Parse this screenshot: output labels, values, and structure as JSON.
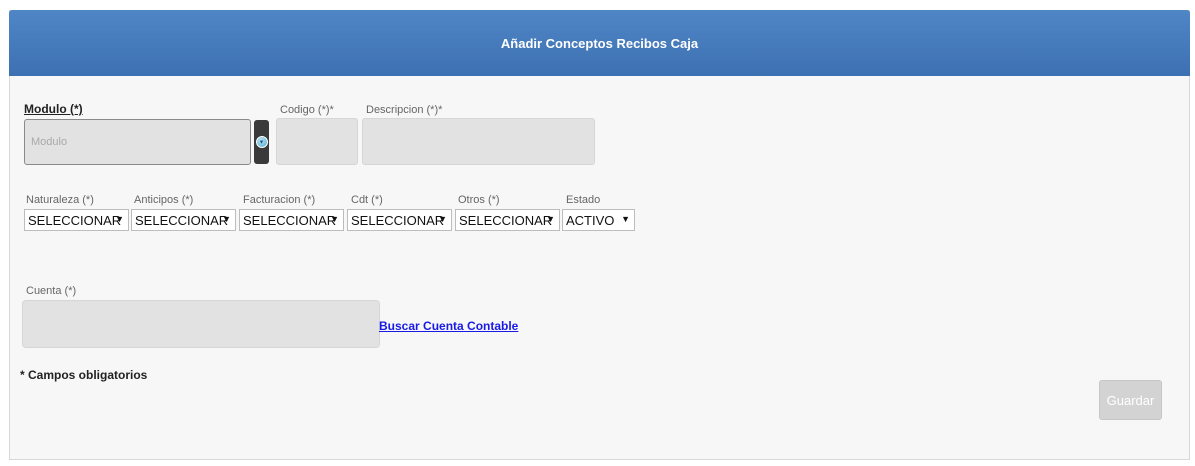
{
  "header": {
    "title": "Añadir Conceptos Recibos Caja"
  },
  "modulo": {
    "label": "Modulo (*)",
    "placeholder": "Modulo"
  },
  "codigo": {
    "label": "Codigo (*)*"
  },
  "descripcion": {
    "label": "Descripcion (*)*"
  },
  "selects": [
    {
      "label": "Naturaleza (*)",
      "value": "SELECCIONAR"
    },
    {
      "label": "Anticipos (*)",
      "value": "SELECCIONAR"
    },
    {
      "label": "Facturacion (*)",
      "value": "SELECCIONAR"
    },
    {
      "label": "Cdt (*)",
      "value": "SELECCIONAR"
    },
    {
      "label": "Otros (*)",
      "value": "SELECCIONAR"
    },
    {
      "label": "Estado",
      "value": "ACTIVO"
    }
  ],
  "cuenta": {
    "label": "Cuenta (*)",
    "link": "Buscar Cuenta Contable"
  },
  "footer": {
    "note": "* Campos obligatorios",
    "save_label": "Guardar"
  },
  "icons": {
    "dropdown_arrow": "▼",
    "lookup": "chevron-down-circle-icon"
  },
  "colors": {
    "header": "#4a7fc1",
    "link": "#1a1ae6"
  }
}
